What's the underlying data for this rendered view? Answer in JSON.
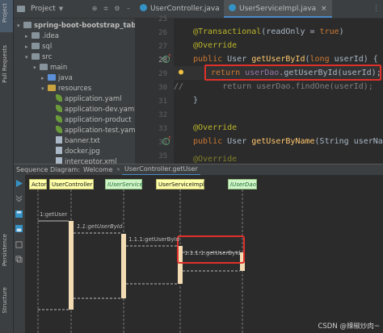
{
  "left_strip": {
    "project_tab": "Project",
    "pull_requests_tab": "Pull Requests",
    "persistence_tab": "Persistence",
    "structure_tab": "Structure"
  },
  "project_panel": {
    "title": "Project",
    "tree": [
      {
        "label": "spring-boot-bootstrap_table",
        "kind": "folder",
        "depth": 0,
        "expanded": true
      },
      {
        "label": ".idea",
        "kind": "folder",
        "depth": 1,
        "expanded": false
      },
      {
        "label": "sql",
        "kind": "folder",
        "depth": 1,
        "expanded": false
      },
      {
        "label": "src",
        "kind": "folder",
        "depth": 1,
        "expanded": true
      },
      {
        "label": "main",
        "kind": "folder",
        "depth": 2,
        "expanded": true
      },
      {
        "label": "java",
        "kind": "folder-blue",
        "depth": 3,
        "expanded": false
      },
      {
        "label": "resources",
        "kind": "folder-res",
        "depth": 3,
        "expanded": true
      },
      {
        "label": "application.yaml",
        "kind": "leaf",
        "depth": 4
      },
      {
        "label": "application-dev.yaml",
        "kind": "leaf",
        "depth": 4
      },
      {
        "label": "application-product",
        "kind": "leaf",
        "depth": 4
      },
      {
        "label": "application-test.yam",
        "kind": "leaf",
        "depth": 4
      },
      {
        "label": "banner.txt",
        "kind": "file",
        "depth": 4
      },
      {
        "label": "docker.jpg",
        "kind": "file",
        "depth": 4
      },
      {
        "label": "interceptor.xml",
        "kind": "file",
        "depth": 4
      }
    ]
  },
  "editor": {
    "tabs": [
      {
        "label": "UserController.java",
        "active": false
      },
      {
        "label": "UserServiceImpl.java",
        "active": true
      }
    ],
    "line_numbers": [
      "25",
      "26",
      "27",
      "28",
      "29",
      "30",
      "31",
      "32",
      "33",
      "34",
      "35"
    ],
    "code": {
      "l25": "",
      "l26_annotation": "@Transactional",
      "l26_args": "(readOnly = ",
      "l26_true": "true",
      "l26_close": ")",
      "l27": "@Override",
      "l28_kw": "public",
      "l28_type": " User ",
      "l28_fn": "getUserById",
      "l28_rest_a": "(",
      "l28_kw2": "long",
      "l28_rest_b": " userId) {",
      "l29_kw": "return",
      "l29_field": " userDao",
      "l29_rest": ".getUserById(userId);",
      "l30": "//        return userDao.findOne(userId);",
      "l31": "}",
      "l33": "@Override",
      "l34_kw": "public",
      "l34_type": " User ",
      "l34_fn": "getUserByName",
      "l34_rest": "(String userName",
      "l36": "@Override"
    }
  },
  "sequence_panel": {
    "title": "Sequence Diagram:",
    "tabs": [
      "Welcome",
      "UserController.getUser"
    ],
    "lifelines": [
      "Actor",
      "UserController",
      "IUserService",
      "UserServiceImpl",
      "IUserDao"
    ],
    "messages": [
      "1:getUser",
      "1.1:getUserById",
      "1.1.1:getUserById",
      "1.1.1.1:getUserById"
    ]
  },
  "watermark": "CSDN @辣椒炒肉~",
  "colors": {
    "highlight_box": "#e0302a",
    "actor_box": "#ffffaa",
    "lifeline_green": "#d2f5c8",
    "activation": "#f3dcb4"
  }
}
